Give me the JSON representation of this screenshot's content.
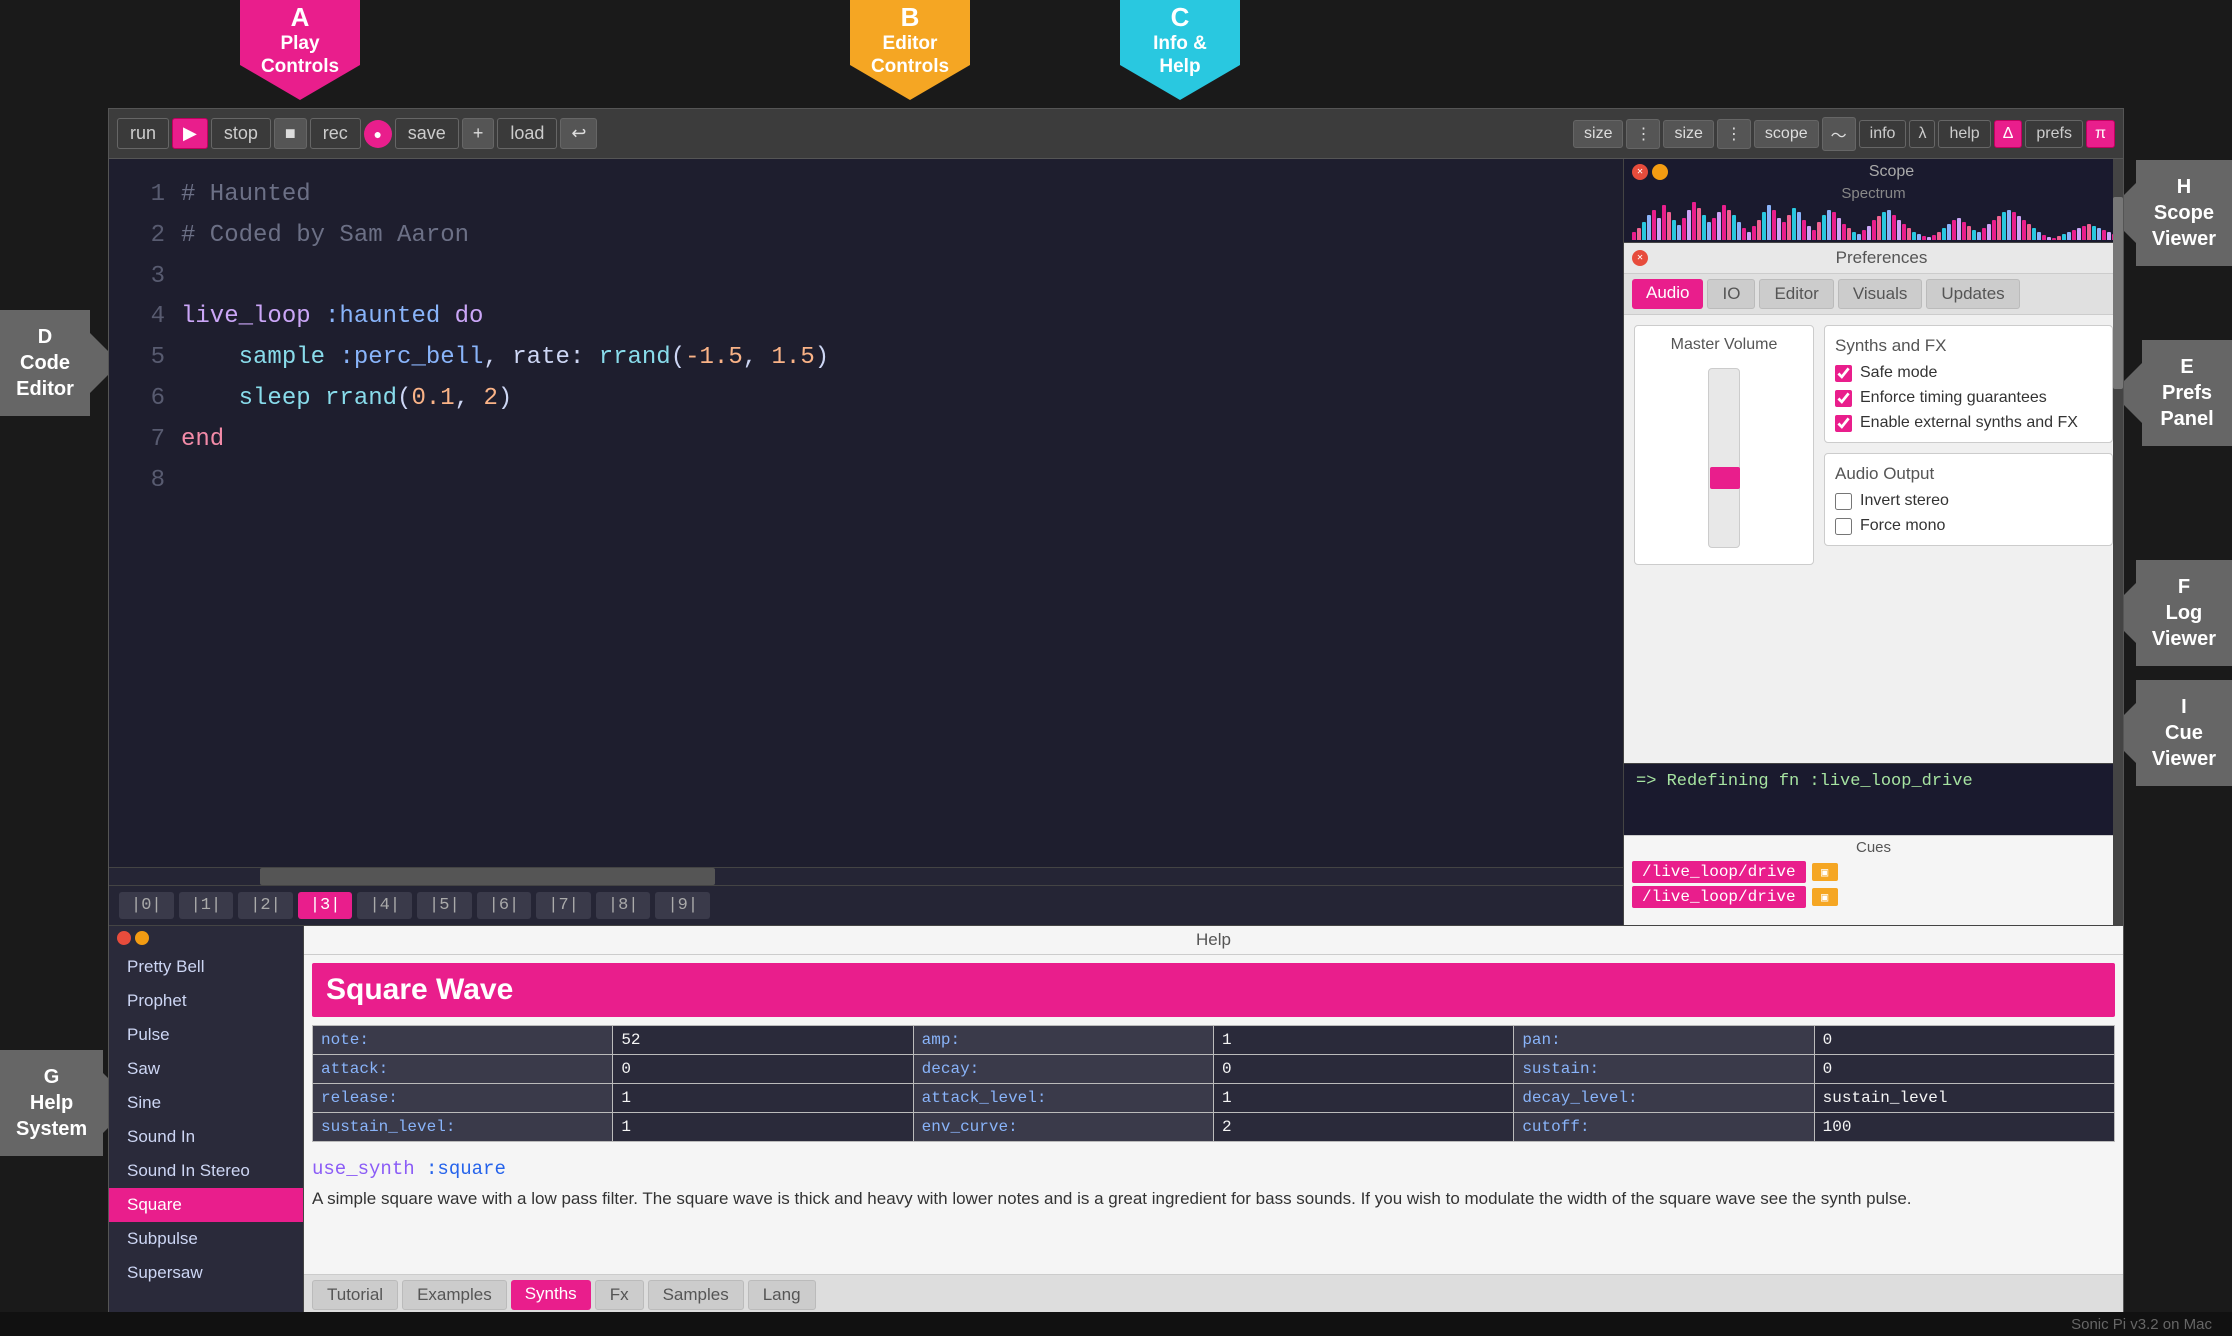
{
  "app": {
    "title": "Sonic Pi v3.2 on Mac"
  },
  "arrows": {
    "a": {
      "letter": "A",
      "label": "Play\nControls"
    },
    "b": {
      "letter": "B",
      "label": "Editor\nControls"
    },
    "c": {
      "letter": "C",
      "label": "Info &\nHelp"
    }
  },
  "side_labels": {
    "d": {
      "letter": "D",
      "label": "Code\nEditor"
    },
    "e": {
      "letter": "E",
      "label": "Prefs\nPanel"
    },
    "f": {
      "letter": "F",
      "label": "Log\nViewer"
    },
    "g": {
      "letter": "G",
      "label": "Help\nSystem"
    },
    "h": {
      "letter": "H",
      "label": "Scope\nViewer"
    },
    "i": {
      "letter": "I",
      "label": "Cue\nViewer"
    }
  },
  "toolbar": {
    "run": "run",
    "stop": "stop",
    "rec": "rec",
    "save": "save",
    "load": "load",
    "size_labels": [
      "size",
      "size"
    ],
    "scope": "scope",
    "info": "info",
    "help": "help",
    "prefs": "prefs"
  },
  "code": {
    "lines": [
      {
        "num": "1",
        "content": "# Haunted",
        "type": "comment"
      },
      {
        "num": "2",
        "content": "# Coded by Sam Aaron",
        "type": "comment"
      },
      {
        "num": "3",
        "content": "",
        "type": "blank"
      },
      {
        "num": "4",
        "content": "live_loop :haunted do",
        "type": "code"
      },
      {
        "num": "5",
        "content": "  sample :perc_bell, rate: rrand(-1.5, 1.5)",
        "type": "code"
      },
      {
        "num": "6",
        "content": "  sleep rrand(0.1, 2)",
        "type": "code"
      },
      {
        "num": "7",
        "content": "end",
        "type": "code"
      },
      {
        "num": "8",
        "content": "",
        "type": "blank"
      }
    ]
  },
  "tabs": [
    "|0|",
    "|1|",
    "|2|",
    "|3|",
    "|4|",
    "|5|",
    "|6|",
    "|7|",
    "|8|",
    "|9|"
  ],
  "active_tab": 3,
  "scope": {
    "title": "Scope",
    "spectrum_title": "Spectrum"
  },
  "prefs": {
    "title": "Preferences",
    "tabs": [
      "Audio",
      "IO",
      "Editor",
      "Visuals",
      "Updates"
    ],
    "active_tab": "Audio",
    "master_volume_label": "Master Volume",
    "synths_fx": {
      "title": "Synths and FX",
      "options": [
        {
          "id": "safe_mode",
          "label": "Safe mode",
          "checked": true
        },
        {
          "id": "enforce_timing",
          "label": "Enforce timing guarantees",
          "checked": true
        },
        {
          "id": "enable_external",
          "label": "Enable external synths and FX",
          "checked": true
        }
      ]
    },
    "audio_output": {
      "title": "Audio Output",
      "options": [
        {
          "id": "invert_stereo",
          "label": "Invert stereo",
          "checked": false
        },
        {
          "id": "force_mono",
          "label": "Force mono",
          "checked": false
        }
      ]
    }
  },
  "log": {
    "entry": "=> Redefining fn :live_loop_drive"
  },
  "cues": {
    "title": "Cues",
    "items": [
      "/live_loop/drive",
      "/live_loop/drive"
    ]
  },
  "help_system": {
    "title": "Help",
    "nav_items": [
      "Pretty Bell",
      "Prophet",
      "Pulse",
      "Saw",
      "Sine",
      "Sound In",
      "Sound In Stereo",
      "Square",
      "Subpulse",
      "Supersaw"
    ],
    "active_item": "Square",
    "synth_title": "Square Wave",
    "params": [
      {
        "label": "note:",
        "value": "52"
      },
      {
        "label": "amp:",
        "value": "1"
      },
      {
        "label": "pan:",
        "value": "0"
      },
      {
        "label": "attack:",
        "value": "0"
      },
      {
        "label": "decay:",
        "value": "0"
      },
      {
        "label": "sustain:",
        "value": "0"
      },
      {
        "label": "release:",
        "value": "1"
      },
      {
        "label": "attack_level:",
        "value": "1"
      },
      {
        "label": "decay_level:",
        "value": "sustain_level"
      },
      {
        "label": "sustain_level:",
        "value": "1"
      },
      {
        "label": "env_curve:",
        "value": "2"
      },
      {
        "label": "cutoff:",
        "value": "100"
      }
    ],
    "use_synth_text": "use_synth :square",
    "description": "A simple square wave with a low pass filter. The square wave is thick and heavy with lower notes and is a great ingredient for bass sounds. If you wish to modulate the width of the square wave see the synth pulse.",
    "tabs": [
      "Tutorial",
      "Examples",
      "Synths",
      "Fx",
      "Samples",
      "Lang"
    ],
    "active_tab": "Synths"
  },
  "colors": {
    "pink": "#e91e8c",
    "orange": "#f5a623",
    "cyan": "#29c8e0",
    "dark_bg": "#1e1e2e",
    "panel_bg": "#2d2d2d"
  }
}
